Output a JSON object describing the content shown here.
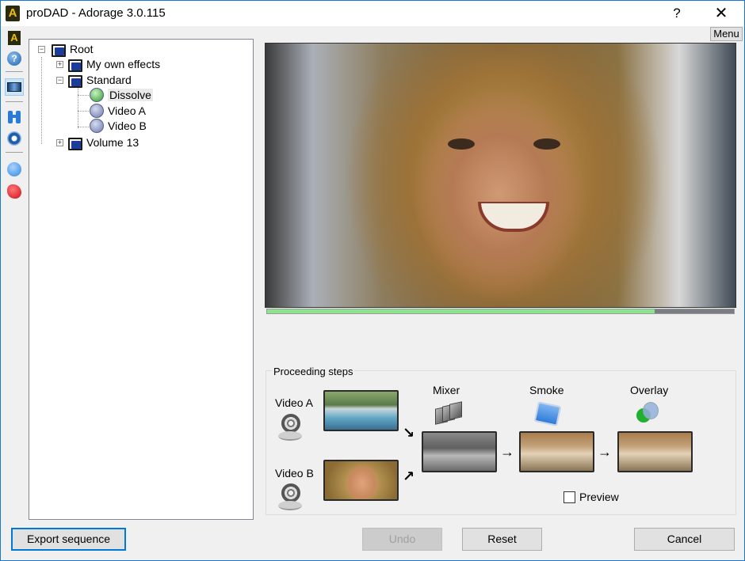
{
  "window": {
    "title": "proDAD - Adorage 3.0.115",
    "app_icon_glyph": "A",
    "help_glyph": "?",
    "close_glyph": "✕"
  },
  "toolbar": {
    "items": [
      {
        "name": "adorage-logo-icon",
        "color": "#2a2a10"
      },
      {
        "name": "help-icon",
        "color": "#1f6fc4"
      },
      {
        "name": "preview-monitor-icon",
        "color": "#1a4f8f",
        "active": true
      },
      {
        "name": "binoculars-icon",
        "color": "#2a7ad8"
      },
      {
        "name": "gear-icon",
        "color": "#1f5fa8"
      },
      {
        "name": "globe-icon",
        "color": "#2f86e0"
      },
      {
        "name": "delete-icon",
        "color": "#e0202a"
      }
    ]
  },
  "menu_button": {
    "label": "Menu"
  },
  "tree": {
    "root": {
      "label": "Root",
      "expanded": true
    },
    "children": [
      {
        "label": "My own effects",
        "expanded": false
      },
      {
        "label": "Standard",
        "expanded": true,
        "children": [
          {
            "label": "Dissolve",
            "selected": true
          },
          {
            "label": "Video A"
          },
          {
            "label": "Video B"
          }
        ]
      },
      {
        "label": "Volume 13",
        "expanded": false
      }
    ]
  },
  "preview": {
    "progress_percent": 83
  },
  "proceeding_steps": {
    "title": "Proceeding steps",
    "inputs": [
      {
        "label": "Video A"
      },
      {
        "label": "Video B"
      }
    ],
    "stages": [
      {
        "label": "Mixer"
      },
      {
        "label": "Smoke"
      },
      {
        "label": "Overlay"
      }
    ],
    "preview_checkbox": {
      "label": "Preview",
      "checked": false
    },
    "arrow_glyph_down_right": "↘",
    "arrow_glyph_up_right": "↗",
    "arrow_glyph_right": "→"
  },
  "buttons": {
    "export": "Export sequence",
    "undo": "Undo",
    "reset": "Reset",
    "cancel": "Cancel"
  }
}
